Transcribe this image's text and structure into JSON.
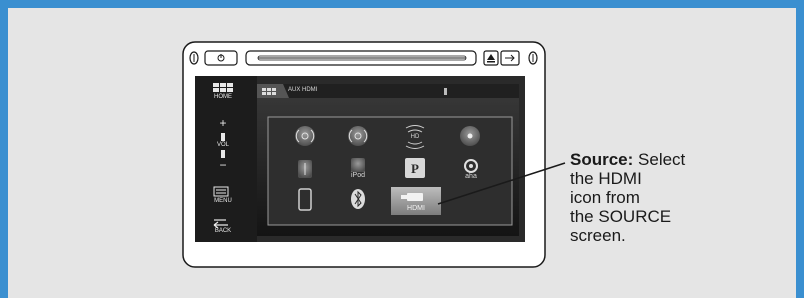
{
  "head_unit": {
    "sidebar": {
      "home_label": "HOME",
      "vol_label": "VOL",
      "vol_plus": "+",
      "vol_minus": "−",
      "menu_label": "MENU",
      "back_label": "BACK"
    },
    "screen": {
      "header_text": "AUX HDMI",
      "icons": [
        {
          "name": "fm-radio-icon",
          "label": ""
        },
        {
          "name": "am-radio-icon",
          "label": ""
        },
        {
          "name": "hd-radio-icon",
          "label": "HD"
        },
        {
          "name": "disc-icon",
          "label": ""
        },
        {
          "name": "usb-icon",
          "label": ""
        },
        {
          "name": "ipod-icon",
          "label": "iPod"
        },
        {
          "name": "pandora-icon",
          "label": "P"
        },
        {
          "name": "aha-icon",
          "label": "aha"
        },
        {
          "name": "phone-icon",
          "label": ""
        },
        {
          "name": "bluetooth-icon",
          "label": ""
        },
        {
          "name": "hdmi-icon",
          "label": "HDMI",
          "selected": true
        }
      ]
    }
  },
  "callout": {
    "bold": "Source:",
    "lines": [
      " Select",
      "the HDMI",
      "icon from",
      "the SOURCE",
      "screen."
    ]
  },
  "colors": {
    "border": "#3a8fd0",
    "background": "#e5e5e5"
  }
}
